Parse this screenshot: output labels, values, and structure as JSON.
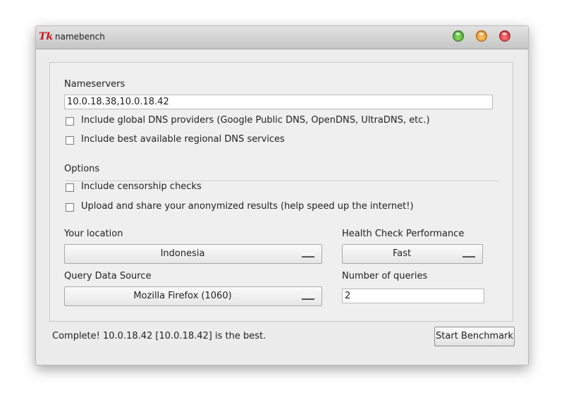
{
  "window": {
    "title": "namebench",
    "icon": "tk-feather-icon"
  },
  "nameservers": {
    "heading": "Nameservers",
    "value": "10.0.18.38,10.0.18.42",
    "include_global_label": "Include global DNS providers (Google Public DNS, OpenDNS, UltraDNS, etc.)",
    "include_global_checked": false,
    "include_regional_label": "Include best available regional DNS services",
    "include_regional_checked": false
  },
  "options": {
    "heading": "Options",
    "censorship_label": "Include censorship checks",
    "censorship_checked": false,
    "upload_label": "Upload and share your anonymized results (help speed up the internet!)",
    "upload_checked": false
  },
  "location": {
    "label": "Your location",
    "value": "Indonesia"
  },
  "health": {
    "label": "Health Check Performance",
    "value": "Fast"
  },
  "query_source": {
    "label": "Query Data Source",
    "value": "Mozilla Firefox (1060)"
  },
  "queries": {
    "label": "Number of queries",
    "value": "2"
  },
  "status": {
    "text": "Complete! 10.0.18.42 [10.0.18.42] is the best."
  },
  "actions": {
    "start_label": "Start Benchmark"
  },
  "colors": {
    "window_bg": "#ececec",
    "close": "#c4141c",
    "minimize": "#d8770e",
    "zoom": "#2e8f1a"
  }
}
